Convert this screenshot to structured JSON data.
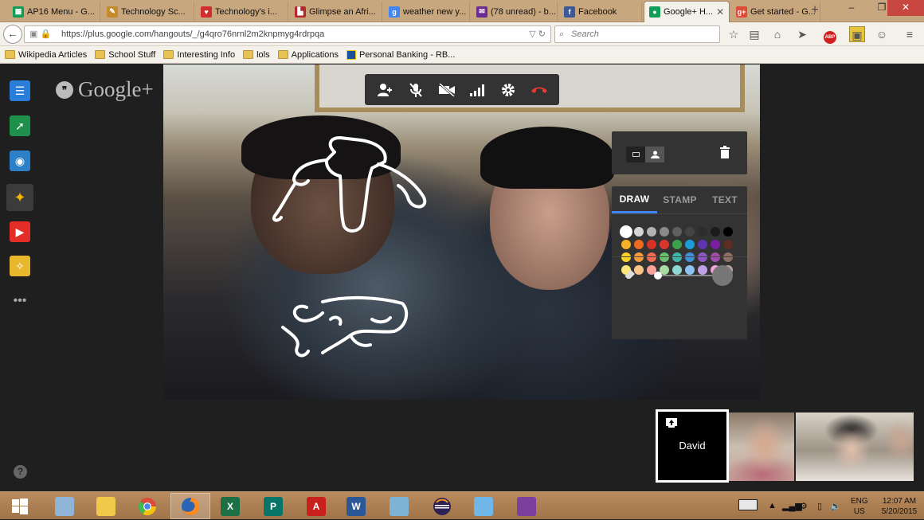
{
  "browser": {
    "tabs": [
      {
        "title": "AP16 Menu - G...",
        "icon": "sheets-icon",
        "color": "#0f9d58",
        "glyph": "▦"
      },
      {
        "title": "Technology Sc...",
        "icon": "hammer-icon",
        "color": "#c38b2b",
        "glyph": "✎"
      },
      {
        "title": "Technology's i...",
        "icon": "heart-icon",
        "color": "#d22d2d",
        "glyph": "♥"
      },
      {
        "title": "Glimpse an Afri...",
        "icon": "bookmark-icon",
        "color": "#b02a2a",
        "glyph": "▙"
      },
      {
        "title": "weather new y...",
        "icon": "google-icon",
        "color": "#4285f4",
        "glyph": "g"
      },
      {
        "title": "(78 unread) - b...",
        "icon": "mail-icon",
        "color": "#6b2b8f",
        "glyph": "✉"
      },
      {
        "title": "Facebook",
        "icon": "facebook-icon",
        "color": "#3b5998",
        "glyph": "f"
      },
      {
        "title": "Google+ H...",
        "icon": "hangouts-icon",
        "color": "#0f9d58",
        "glyph": "●",
        "active": true
      },
      {
        "title": "Get started - G...",
        "icon": "google-plus-icon",
        "color": "#dd4b39",
        "glyph": "g+"
      }
    ],
    "new_tab": "+",
    "url": "https://plus.google.com/hangouts/_/g4qro76nrnl2m2knpmyg4rdrpqa",
    "search_placeholder": "Search",
    "bookmarks": [
      {
        "label": "Wikipedia Articles",
        "icon": "folder-icon"
      },
      {
        "label": "School Stuff",
        "icon": "folder-icon"
      },
      {
        "label": "Interesting Info",
        "icon": "folder-icon"
      },
      {
        "label": "lols",
        "icon": "folder-icon"
      },
      {
        "label": "Applications",
        "icon": "folder-icon"
      },
      {
        "label": "Personal Banking - RB...",
        "icon": "bank-icon"
      }
    ]
  },
  "hangouts": {
    "logo_text": "Google+",
    "draw_tabs": [
      "DRAW",
      "STAMP",
      "TEXT"
    ],
    "active_tab": "DRAW",
    "palette_rows": [
      [
        "#ffffff",
        "#d6d6d6",
        "#b3b3b3",
        "#8a8a8a",
        "#5f5f5f",
        "#444444",
        "#2d2d2d",
        "#1b1b1b",
        "#000000"
      ],
      [
        "#f6b026",
        "#ee6a1e",
        "#d83224",
        "#d9352c",
        "#3ea04a",
        "#1b9bd7",
        "#5e35b1",
        "#7b1fa2",
        "#5d2c22"
      ],
      [
        "#fbd125",
        "#f89b3c",
        "#f26a50",
        "#68c06c",
        "#3fb7a6",
        "#3f8fd9",
        "#8e56c5",
        "#a14ca8",
        "#8d6e63"
      ],
      [
        "#fde67a",
        "#fbc58a",
        "#f7a39a",
        "#a9dba2",
        "#8fd8d2",
        "#8cc4ef",
        "#c1a1e6",
        "#f0a3dc",
        "#bca39a"
      ]
    ],
    "selected_color": "#ffffff",
    "brush_size": 0.0,
    "participant_name": "David"
  },
  "taskbar": {
    "apps": [
      {
        "name": "start-icon",
        "color": "#ffffff"
      },
      {
        "name": "calculator-icon",
        "color": "#8fb4d6"
      },
      {
        "name": "file-explorer-icon",
        "color": "#f0c94a"
      },
      {
        "name": "chrome-icon",
        "color": "#dd4b39"
      },
      {
        "name": "firefox-icon",
        "color": "#ff7f1e"
      },
      {
        "name": "excel-icon",
        "color": "#1d7044",
        "letter": "X"
      },
      {
        "name": "publisher-icon",
        "color": "#077568",
        "letter": "P"
      },
      {
        "name": "acrobat-icon",
        "color": "#c8201c",
        "letter": "A"
      },
      {
        "name": "word-icon",
        "color": "#2b5797",
        "letter": "W"
      },
      {
        "name": "paint-icon",
        "color": "#7fb3d5"
      },
      {
        "name": "eclipse-icon",
        "color": "#2c2255"
      },
      {
        "name": "snipping-tool-icon",
        "color": "#6fb7e8"
      },
      {
        "name": "winrar-icon",
        "color": "#7b3f9e"
      }
    ],
    "lang_1": "ENG",
    "lang_2": "US",
    "time": "12:07 AM",
    "date": "5/20/2015"
  }
}
